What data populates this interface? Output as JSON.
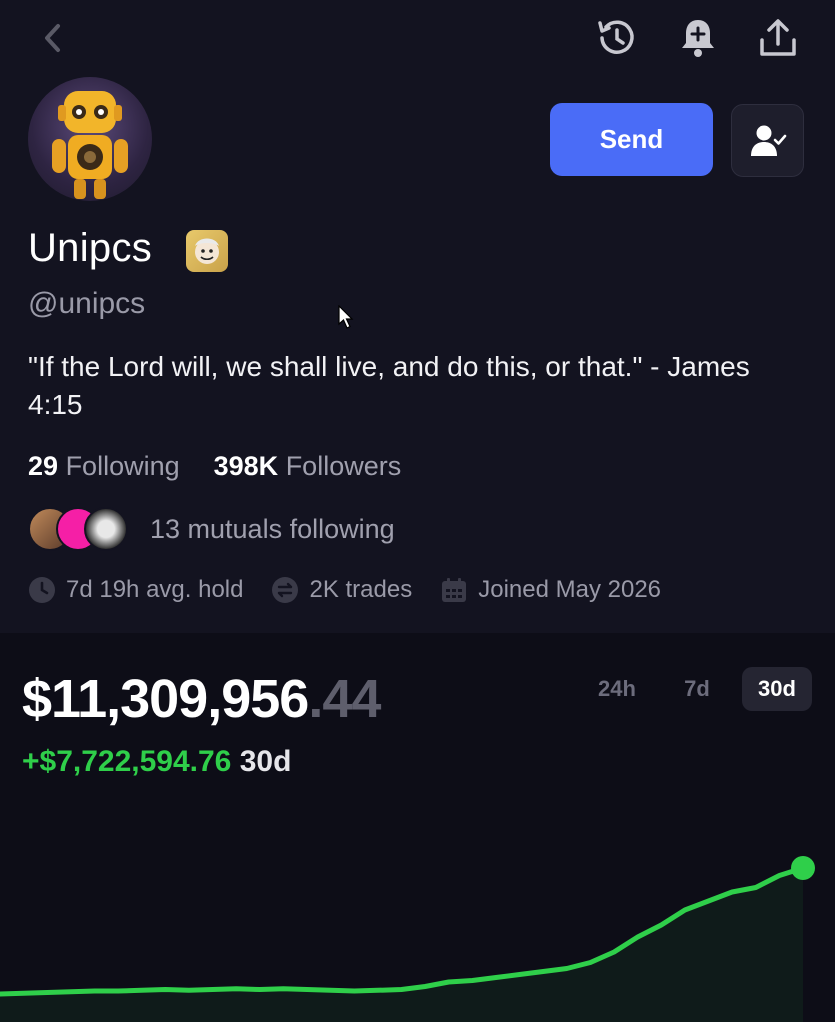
{
  "profile": {
    "name": "Unipcs",
    "handle": "@unipcs",
    "bio": "\"If the Lord will, we shall live, and do this, or that.\" - James 4:15"
  },
  "actions": {
    "send_label": "Send"
  },
  "stats": {
    "following_count": "29",
    "following_label": "Following",
    "followers_count": "398K",
    "followers_label": "Followers"
  },
  "mutuals": {
    "text": "13 mutuals following"
  },
  "meta": {
    "avg_hold": "7d 19h avg. hold",
    "trades": "2K trades",
    "joined": "Joined May 2026"
  },
  "portfolio": {
    "balance_main": "$11,309,956",
    "balance_cents": ".44",
    "change_value": "+$7,722,594.76",
    "change_period": "30d",
    "ranges": [
      "24h",
      "7d",
      "30d"
    ],
    "active_range": "30d",
    "accent_color": "#2fcf4a"
  },
  "icons": {
    "back": "chevron-left-icon",
    "history": "history-icon",
    "notify": "bell-plus-icon",
    "share": "share-icon",
    "follow": "user-check-icon"
  },
  "chart_data": {
    "type": "line",
    "series": [
      {
        "values": [
          0.04,
          0.045,
          0.05,
          0.055,
          0.06,
          0.06,
          0.065,
          0.07,
          0.065,
          0.07,
          0.075,
          0.07,
          0.075,
          0.07,
          0.065,
          0.06,
          0.065,
          0.07,
          0.09,
          0.12,
          0.13,
          0.15,
          0.17,
          0.19,
          0.21,
          0.25,
          0.32,
          0.42,
          0.5,
          0.6,
          0.66,
          0.72,
          0.75,
          0.83,
          0.88
        ]
      }
    ]
  }
}
